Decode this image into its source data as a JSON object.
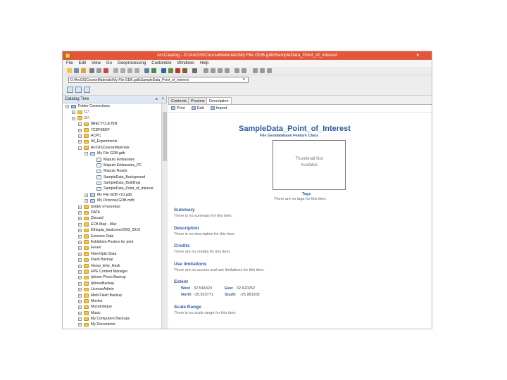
{
  "window": {
    "title": "ArcCatalog - D:\\ArcGISCourseMaterials\\My File GDB.gdb\\SampleData_Point_of_Interest",
    "controls": "»"
  },
  "menu": [
    "File",
    "Edit",
    "View",
    "Go",
    "Geoprocessing",
    "Customize",
    "Windows",
    "Help"
  ],
  "location": {
    "value": "D:\\ArcGISCourseMaterials\\My File GDB.gdb\\SampleData_Point_of_Interest"
  },
  "catalog": {
    "title": "Catalog Tree",
    "pin": "⩚",
    "close": "×",
    "items": [
      {
        "label": "Folder Connections",
        "exp": "−",
        "icon": "conn"
      },
      {
        "label": "C:\\",
        "exp": "+",
        "icon": "folder"
      },
      {
        "label": "D:\\",
        "exp": "−",
        "icon": "folder"
      },
      {
        "label": "$RECYCLE.BIN",
        "exp": "+",
        "icon": "folder"
      },
      {
        "label": "7CDF6BDF",
        "exp": "+",
        "icon": "folder"
      },
      {
        "label": "ACPC",
        "exp": "+",
        "icon": "folder"
      },
      {
        "label": "All_Experiments",
        "exp": "+",
        "icon": "folder"
      },
      {
        "label": "ArcGISCourseMaterials",
        "exp": "−",
        "icon": "folder"
      },
      {
        "label": "My File GDB.gdb",
        "exp": "−",
        "icon": "gdb"
      },
      {
        "label": "Maputo Embassies",
        "exp": "",
        "icon": "fc"
      },
      {
        "label": "Maputo Embassies_PC",
        "exp": "",
        "icon": "fc"
      },
      {
        "label": "Maputo Roads",
        "exp": "",
        "icon": "fc"
      },
      {
        "label": "SampleData_Background",
        "exp": "",
        "icon": "fc"
      },
      {
        "label": "SampleData_Buildings",
        "exp": "",
        "icon": "fc"
      },
      {
        "label": "SampleData_Point_of_Interest",
        "exp": "",
        "icon": "fc"
      },
      {
        "label": "My File GDB v10.gdb",
        "exp": "+",
        "icon": "gdb"
      },
      {
        "label": "My Personal GDB.mdb",
        "exp": "+",
        "icon": "gdb"
      },
      {
        "label": "border of woredas",
        "exp": "+",
        "icon": "folder"
      },
      {
        "label": "DATA",
        "exp": "+",
        "icon": "folder"
      },
      {
        "label": "Discard",
        "exp": "+",
        "icon": "folder"
      },
      {
        "label": "ECB Map - Mac",
        "exp": "+",
        "icon": "folder"
      },
      {
        "label": "Ethiopia_landcover2003_2010",
        "exp": "+",
        "icon": "folder"
      },
      {
        "label": "Exercise Data",
        "exp": "+",
        "icon": "folder"
      },
      {
        "label": "Exhibition Posters for print",
        "exp": "+",
        "icon": "folder"
      },
      {
        "label": "Feven",
        "exp": "+",
        "icon": "folder"
      },
      {
        "label": "FiberOptic Data",
        "exp": "+",
        "icon": "folder"
      },
      {
        "label": "Flash Backup",
        "exp": "+",
        "icon": "folder"
      },
      {
        "label": "Harsa_tehe_Hask",
        "exp": "+",
        "icon": "folder"
      },
      {
        "label": "HPE Content Manager",
        "exp": "+",
        "icon": "folder"
      },
      {
        "label": "Iphone Photo Backup",
        "exp": "+",
        "icon": "folder"
      },
      {
        "label": "IphoneBackup",
        "exp": "+",
        "icon": "folder"
      },
      {
        "label": "LicenseAdmin",
        "exp": "+",
        "icon": "folder"
      },
      {
        "label": "Meilt Flash Backup",
        "exp": "+",
        "icon": "folder"
      },
      {
        "label": "Movies",
        "exp": "+",
        "icon": "folder"
      },
      {
        "label": "Mozambique",
        "exp": "+",
        "icon": "folder"
      },
      {
        "label": "Music",
        "exp": "+",
        "icon": "folder"
      },
      {
        "label": "My Computers Backups",
        "exp": "+",
        "icon": "folder"
      },
      {
        "label": "My Documents",
        "exp": "+",
        "icon": "folder"
      }
    ]
  },
  "tabs": [
    "Contents",
    "Preview",
    "Description"
  ],
  "actions": [
    "Print",
    "Edit",
    "Import"
  ],
  "description": {
    "title": "SampleData_Point_of_Interest",
    "type": "File Geodatabase Feature Class",
    "thumbnail": [
      "Thumbnail Not",
      "Available"
    ],
    "tags_heading": "Tags",
    "tags_text": "There are no tags for this item.",
    "summary_heading": "Summary",
    "summary_text": "There is no summary for this item.",
    "desc_heading": "Description",
    "desc_text": "There is no description for this item.",
    "credits_heading": "Credits",
    "credits_text": "There are no credits for this item.",
    "use_heading": "Use limitations",
    "use_text": "There are no access and use limitations for this item.",
    "extent_heading": "Extent",
    "extent": {
      "west_label": "West",
      "west": "32.544324",
      "east_label": "East",
      "east": "32.620252",
      "north_label": "North",
      "north": "-25.923771",
      "south_label": "South",
      "south": "-25.981932"
    },
    "scale_heading": "Scale Range",
    "scale_text": "There is no scale range for this item."
  },
  "colors": {
    "titlebar": "#e4563a",
    "heading": "#2c5aa0"
  }
}
